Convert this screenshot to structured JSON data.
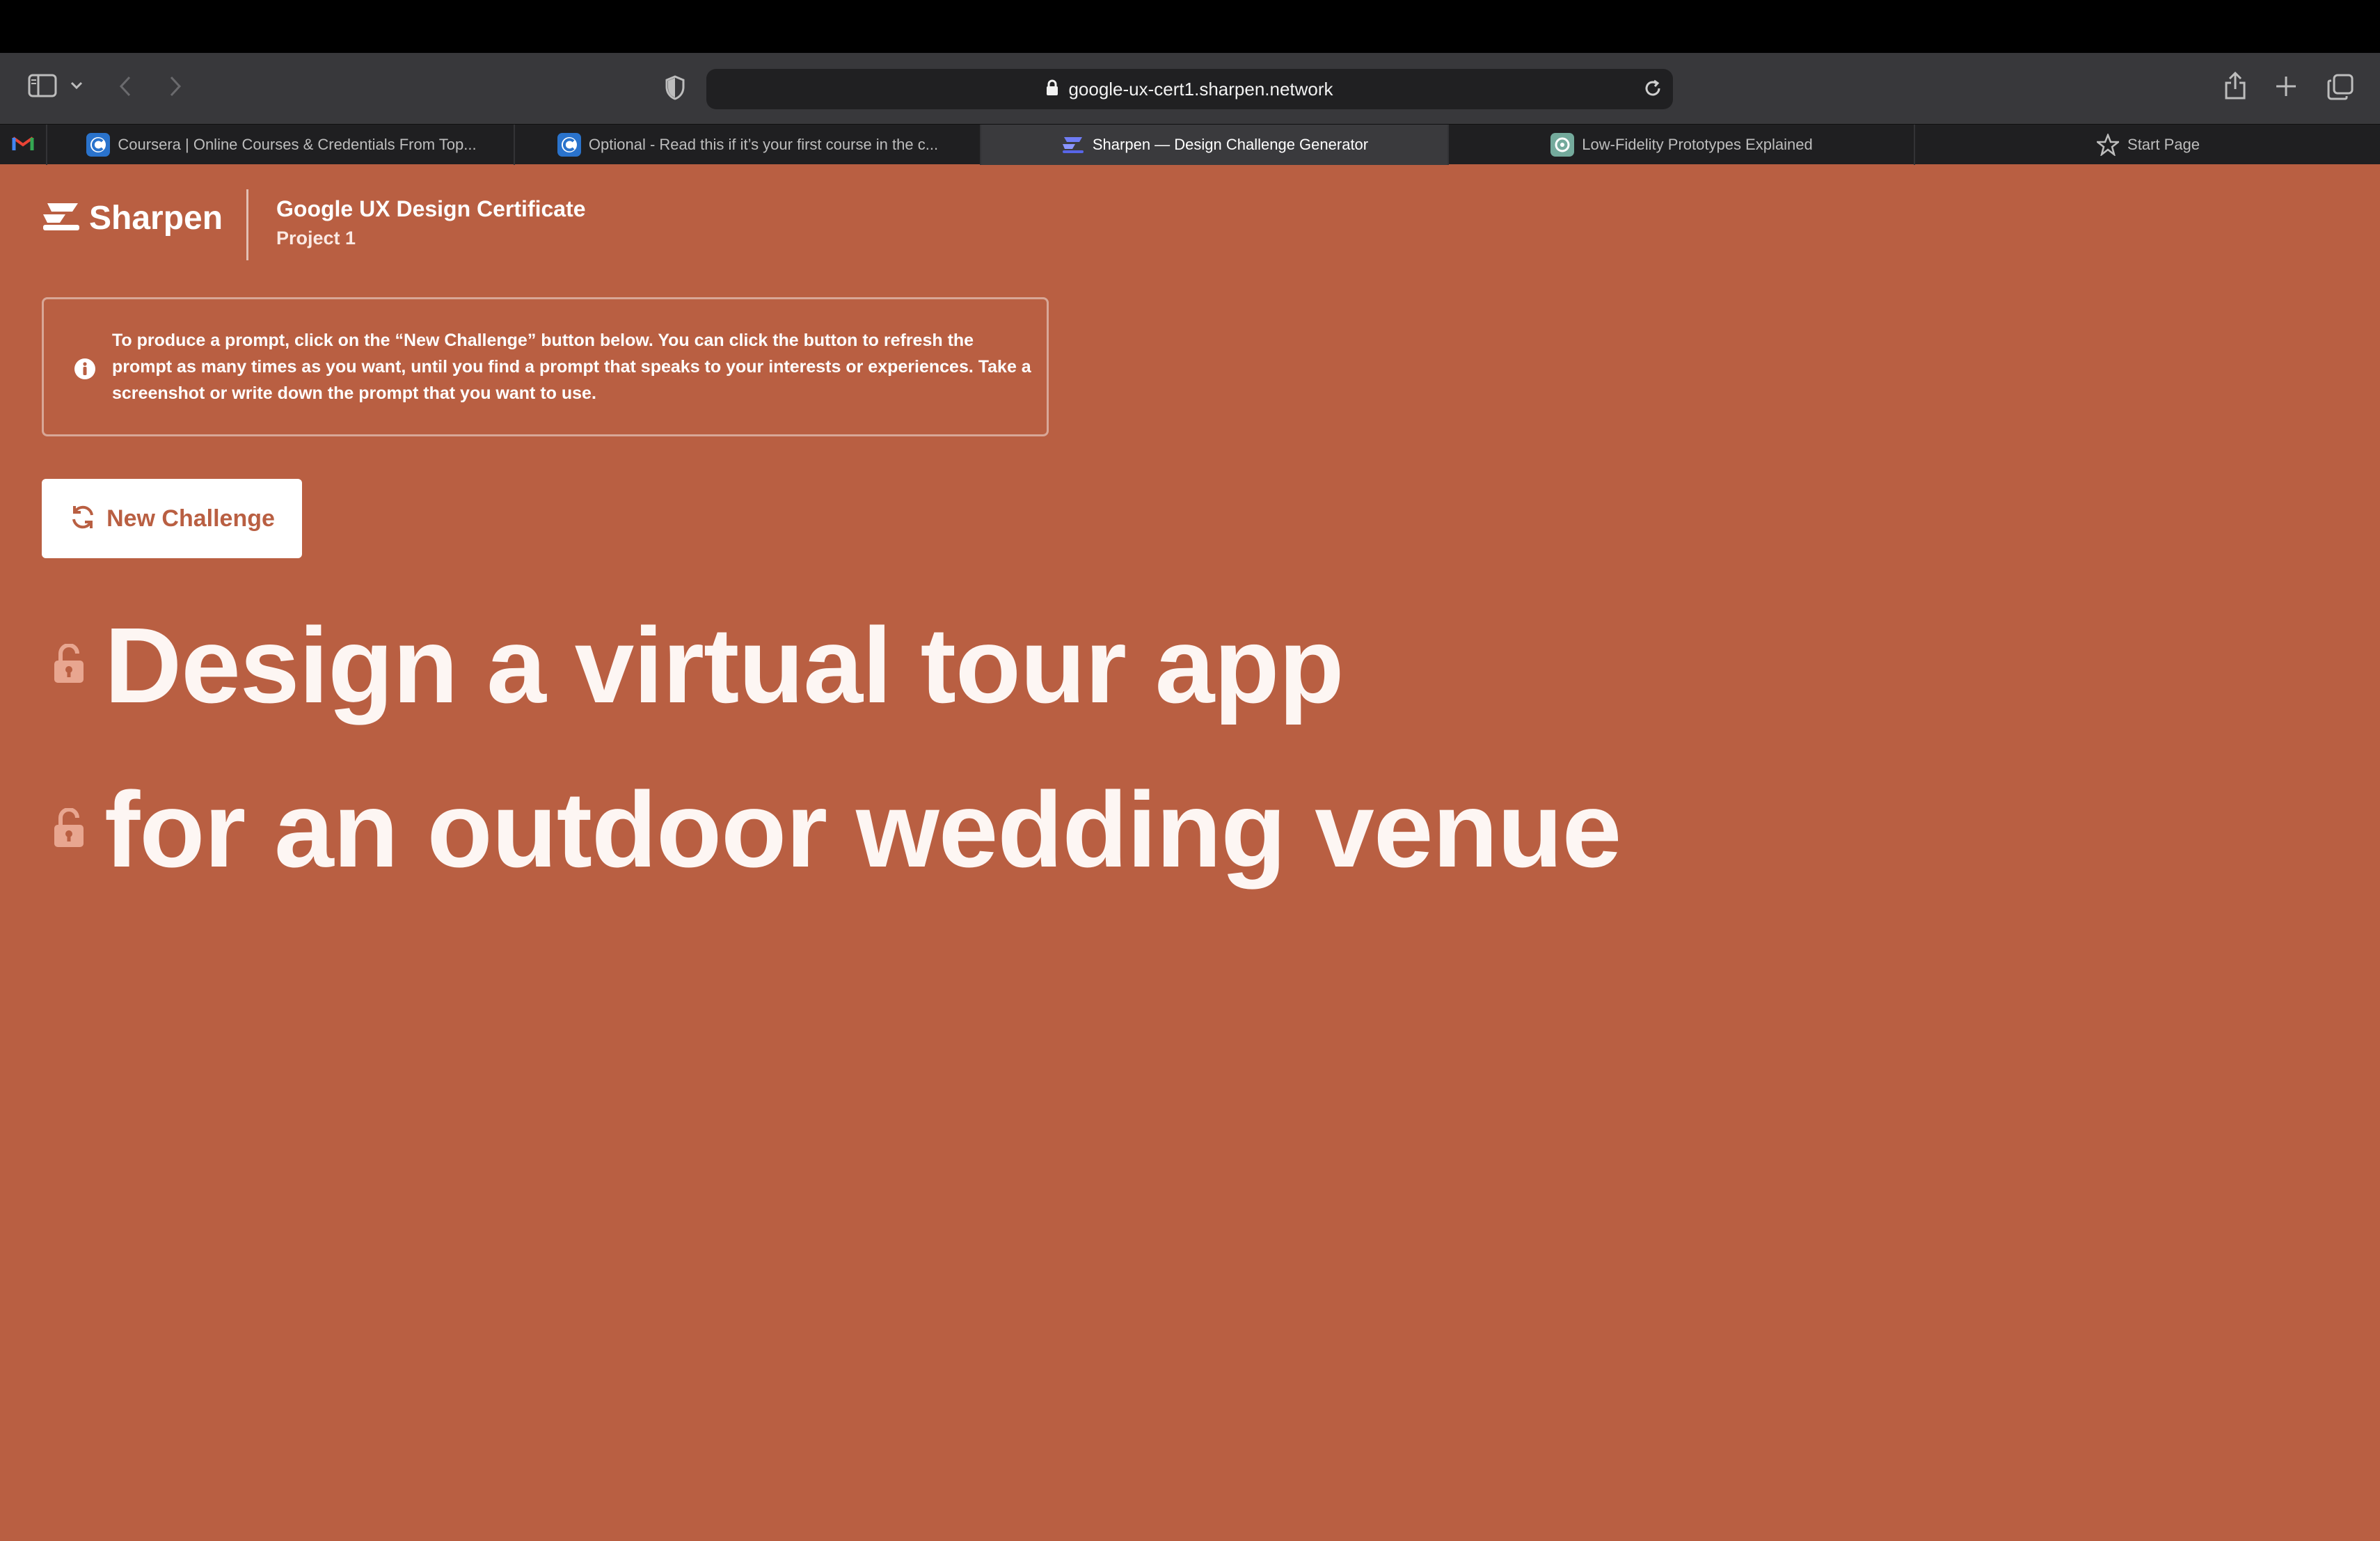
{
  "browser": {
    "url": "google-ux-cert1.sharpen.network",
    "tabs": [
      {
        "label": "Coursera | Online Courses & Credentials From Top...",
        "active": false,
        "icon": "coursera-icon"
      },
      {
        "label": "Optional - Read this if it’s your first course in the c...",
        "active": false,
        "icon": "coursera-icon"
      },
      {
        "label": "Sharpen — Design Challenge Generator",
        "active": true,
        "icon": "sharpen-icon"
      },
      {
        "label": "Low-Fidelity Prototypes Explained",
        "active": false,
        "icon": "openai-icon"
      },
      {
        "label": "Start Page",
        "active": false,
        "icon": "star-icon"
      }
    ]
  },
  "header": {
    "brand": "Sharpen",
    "course_title": "Google UX Design Certificate",
    "course_subtitle": "Project 1"
  },
  "info": {
    "text": "To produce a prompt, click on the “New Challenge” button below. You can click the button to refresh the prompt as many times as you want, until you find a prompt that speaks to your interests or experiences. Take a screenshot or write down the prompt that you want to use."
  },
  "actions": {
    "new_challenge_label": "New Challenge"
  },
  "prompt": {
    "line1": "Design a virtual tour app",
    "line2": "for an outdoor wedding venue"
  },
  "colors": {
    "page_background": "#b95f42",
    "accent": "#b95f42",
    "text": "#ffffff"
  }
}
